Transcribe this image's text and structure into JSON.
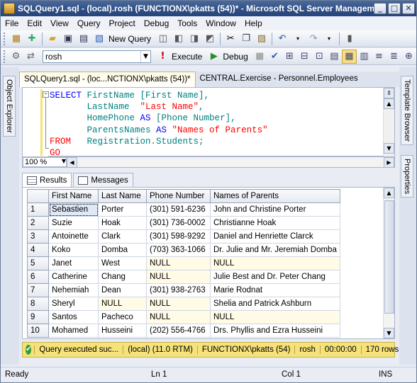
{
  "window": {
    "title": "SQLQuery1.sql - (local).rosh (FUNCTIONX\\pkatts (54))* - Microsoft SQL Server Managem..."
  },
  "menu": [
    "File",
    "Edit",
    "View",
    "Query",
    "Project",
    "Debug",
    "Tools",
    "Window",
    "Help"
  ],
  "toolbar1": {
    "new_query": "New Query"
  },
  "toolbar2": {
    "database": "rosh",
    "execute": "Execute",
    "debug": "Debug"
  },
  "side_left": {
    "object_explorer": "Object Explorer"
  },
  "side_right": {
    "template_browser": "Template Browser",
    "properties": "Properties"
  },
  "doc_tabs": [
    {
      "label": "SQLQuery1.sql - (loc...NCTIONX\\pkatts (54))*",
      "active": true
    },
    {
      "label": "CENTRAL.Exercise - Personnel.Employees",
      "active": false
    }
  ],
  "editor": {
    "l1": {
      "kw": "SELECT",
      "rest": " FirstName [First Name],"
    },
    "l2": {
      "a": "       LastName  ",
      "s": "\"Last Name\"",
      "b": ","
    },
    "l3": {
      "a": "       HomePhone ",
      "kw": "AS",
      "b": " [Phone Number],"
    },
    "l4": {
      "a": "       ParentsNames ",
      "kw": "AS",
      "s": " \"Names of Parents\""
    },
    "l5": {
      "kw": "FROM",
      "rest": "   Registration.Students;"
    },
    "l6": {
      "kw": "GO"
    },
    "zoom": "100 %"
  },
  "result_tabs": {
    "results": "Results",
    "messages": "Messages"
  },
  "grid": {
    "columns": [
      "First Name",
      "Last Name",
      "Phone Number",
      "Names of Parents"
    ],
    "rows": [
      {
        "n": "1",
        "c": [
          "Sebastien",
          "Porter",
          "(301) 591-6236",
          "John and Christine Porter"
        ]
      },
      {
        "n": "2",
        "c": [
          "Suzie",
          "Hoak",
          "(301) 736-0002",
          "Christianne Hoak"
        ]
      },
      {
        "n": "3",
        "c": [
          "Antoinette",
          "Clark",
          "(301) 598-9292",
          "Daniel and Henriette Clarck"
        ]
      },
      {
        "n": "4",
        "c": [
          "Koko",
          "Domba",
          "(703) 363-1066",
          "Dr. Julie and Mr. Jeremiah Domba"
        ]
      },
      {
        "n": "5",
        "c": [
          "Janet",
          "West",
          "NULL",
          "NULL"
        ]
      },
      {
        "n": "6",
        "c": [
          "Catherine",
          "Chang",
          "NULL",
          "Julie Best and Dr. Peter Chang"
        ]
      },
      {
        "n": "7",
        "c": [
          "Nehemiah",
          "Dean",
          "(301) 938-2763",
          "Marie Rodnat"
        ]
      },
      {
        "n": "8",
        "c": [
          "Sheryl",
          "NULL",
          "NULL",
          "Shelia and Patrick Ashburn"
        ]
      },
      {
        "n": "9",
        "c": [
          "Santos",
          "Pacheco",
          "NULL",
          "NULL"
        ]
      },
      {
        "n": "10",
        "c": [
          "Mohamed",
          "Husseini",
          "(202) 556-4766",
          "Drs. Phyllis and Ezra Husseini"
        ]
      }
    ]
  },
  "query_status": {
    "message": "Query executed suc...",
    "server": "(local) (11.0 RTM)",
    "login": "FUNCTIONX\\pkatts (54)",
    "database": "rosh",
    "time": "00:00:00",
    "rows": "170 rows"
  },
  "statusbar": {
    "ready": "Ready",
    "ln": "Ln 1",
    "col": "Col 1",
    "ins": "INS"
  },
  "colors": {
    "title_bar": "#2f4f86",
    "query_status_bg": "#f5e27a",
    "keyword": "#0000ff",
    "string": "#ff0000"
  }
}
